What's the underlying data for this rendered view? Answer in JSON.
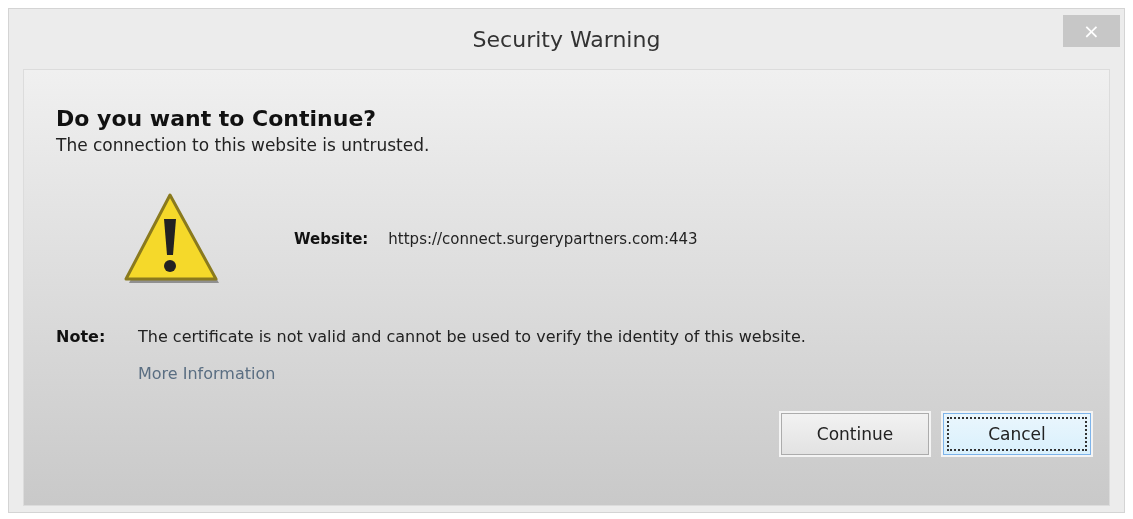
{
  "window": {
    "title": "Security Warning",
    "close": "×"
  },
  "heading": "Do you want to Continue?",
  "subtitle": "The connection to this website is untrusted.",
  "website": {
    "label": "Website:",
    "value": "https://connect.surgerypartners.com:443"
  },
  "note": {
    "label": "Note:",
    "text": "The certificate is not valid and cannot be used to verify the identity of this website.",
    "link": "More Information"
  },
  "buttons": [
    {
      "label": "Continue",
      "focused": false
    },
    {
      "label": "Cancel",
      "focused": true
    }
  ]
}
